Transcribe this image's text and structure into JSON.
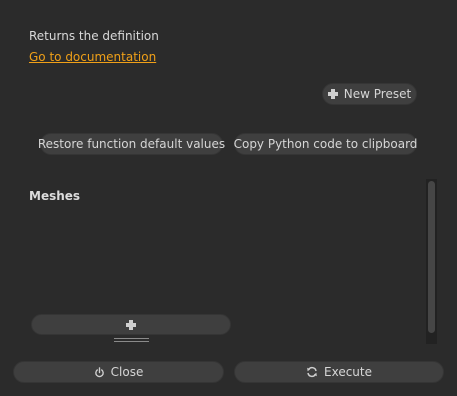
{
  "description": "Returns the definition",
  "doc_link": "Go to documentation",
  "buttons": {
    "new_preset": "New Preset",
    "restore_defaults": "Restore function default values",
    "copy_python": "Copy Python code to clipboard",
    "close": "Close",
    "execute": "Execute"
  },
  "list": {
    "label": "Meshes"
  },
  "icons": {
    "new_preset": "plus-icon",
    "add_item": "plus-icon",
    "close": "power-icon",
    "execute": "refresh-icon"
  },
  "colors": {
    "background": "#2b2b2b",
    "button": "#3f3f3f",
    "link": "#f0a018",
    "text": "#d6d6d6"
  }
}
